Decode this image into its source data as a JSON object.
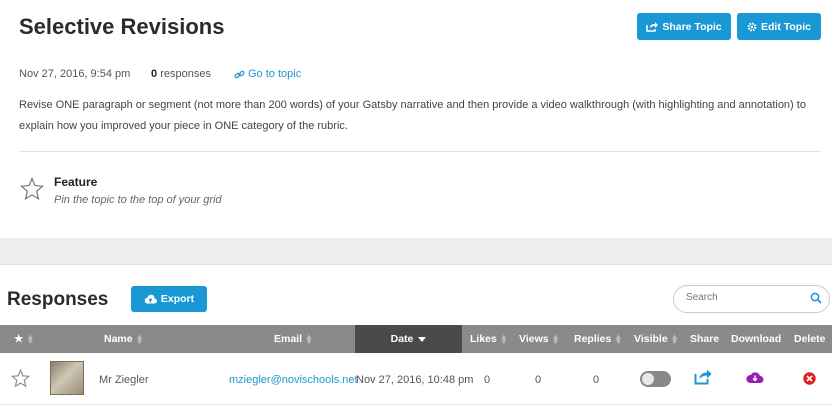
{
  "topic": {
    "title": "Selective Revisions",
    "share_label": "Share Topic",
    "edit_label": "Edit Topic",
    "date": "Nov 27, 2016, 9:54 pm",
    "responses_count": "0",
    "responses_label": "responses",
    "goto_label": "Go to topic",
    "description": "Revise ONE paragraph or segment (not more than 200 words) of your Gatsby narrative and then provide a video walkthrough (with highlighting and annotation) to explain how you improved your piece in ONE category of the rubric."
  },
  "feature": {
    "title": "Feature",
    "subtitle": "Pin the topic to the top of your grid"
  },
  "responses": {
    "title": "Responses",
    "export_label": "Export",
    "search_placeholder": "Search",
    "columns": {
      "name": "Name",
      "email": "Email",
      "date": "Date",
      "likes": "Likes",
      "views": "Views",
      "replies": "Replies",
      "visible": "Visible",
      "share": "Share",
      "download": "Download",
      "delete": "Delete"
    },
    "rows": [
      {
        "name": "Mr Ziegler",
        "email": "mziegler@novischools.net",
        "date": "Nov 27, 2016, 10:48 pm",
        "likes": "0",
        "views": "0",
        "replies": "0",
        "visible": false
      }
    ]
  },
  "colors": {
    "accent": "#1a98d5",
    "header_bg": "#8a8a8a",
    "active_header_bg": "#4a4a4a",
    "download_icon": "#9b1fb5",
    "delete_icon": "#e02020"
  }
}
